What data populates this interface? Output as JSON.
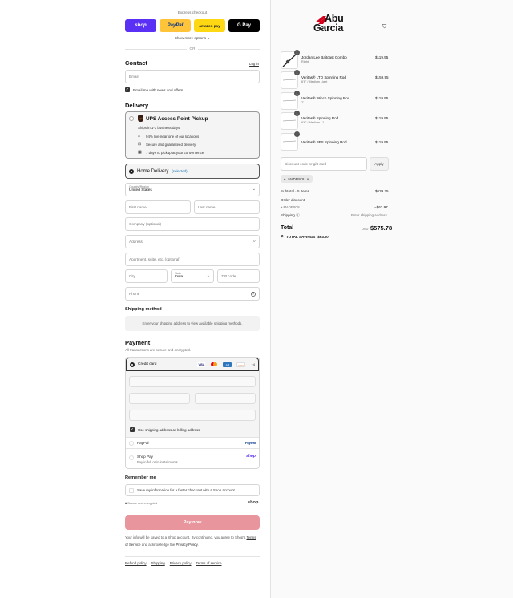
{
  "express": {
    "title": "Express checkout",
    "shop_label": "shop",
    "paypal_label": "PayPal",
    "amazon_label": "amazon pay",
    "gpay_label": "G Pay",
    "more_label": "Show more options",
    "or_label": "OR"
  },
  "contact": {
    "heading": "Contact",
    "login_label": "Log in",
    "email_placeholder": "Email",
    "news_label": "Email me with news and offers"
  },
  "delivery": {
    "heading": "Delivery",
    "ups_title": "UPS Access Point Pickup",
    "ups_subtitle": "Ships in 1-3 business days",
    "ups_features": [
      "94% live near one of our locations",
      "Secure and guaranteed delivery",
      "7 days to pickup at your convenience"
    ],
    "home_label": "Home Delivery",
    "home_selected": "(selected)",
    "country_label": "Country/Region",
    "country_value": "United States",
    "first_name": "First name",
    "last_name": "Last name",
    "company": "Company (optional)",
    "address": "Address",
    "apartment": "Apartment, suite, etc. (optional)",
    "city": "City",
    "state_label": "State",
    "state_value": "Iowa",
    "zip": "ZIP code",
    "phone": "Phone"
  },
  "shipping_method": {
    "heading": "Shipping method",
    "note": "Enter your shipping address to view available shipping methods."
  },
  "payment": {
    "heading": "Payment",
    "subheading": "All transactions are secure and encrypted.",
    "credit_card_label": "Credit card",
    "card_more": "+4",
    "billing_label": "Use shipping address as billing address",
    "paypal_label": "PayPal",
    "paypal_logo": "PayPal",
    "shoppay_label": "Shop Pay",
    "shoppay_sub": "Pay in full or in installments",
    "shoppay_logo": "shop"
  },
  "remember": {
    "heading": "Remember me",
    "save_label": "Save my information for a faster checkout with a Shop account",
    "secure_label": "Secure and encrypted",
    "shop_logo": "shop"
  },
  "pay_button": "Pay now",
  "legal": {
    "text1": "Your info will be saved to a Shop account. By continuing, you agree to Shop's",
    "tos": "Terms of Service",
    "text2": "and acknowledge the",
    "privacy": "Privacy Policy",
    "period": "."
  },
  "footer_links": [
    "Refund policy",
    "Shipping",
    "Privacy policy",
    "Terms of service"
  ],
  "brand": {
    "line1": "Abu",
    "line2": "Garcia"
  },
  "cart": {
    "items": [
      {
        "name": "Jordan Lee Baitcast Combo",
        "variant": "Right",
        "qty": "1",
        "price": "$119.95"
      },
      {
        "name": "Veritas® LTD Spinning Rod",
        "variant": "6'6\" / Medium Light",
        "qty": "1",
        "price": "$159.95"
      },
      {
        "name": "Veritas® Winch Spinning Rod",
        "variant": "7'",
        "qty": "1",
        "price": "$119.95"
      },
      {
        "name": "Veritas® Spinning Rod",
        "variant": "6'6\" / Medium / 1",
        "qty": "1",
        "price": "$119.95"
      },
      {
        "name": "Veritas® BFS Spinning Rod",
        "variant": "",
        "qty": "1",
        "price": "$119.95"
      }
    ],
    "discount_placeholder": "Discount code or gift card",
    "apply_label": "Apply",
    "code_chip": "MADFBC8",
    "subtotal_label": "Subtotal · 5 items",
    "subtotal_value": "$639.75",
    "order_discount_label": "Order discount",
    "order_discount_code": "MADFBC8",
    "order_discount_value": "−$63.97",
    "shipping_label": "Shipping",
    "shipping_value": "Enter shipping address",
    "total_label": "Total",
    "currency": "USD",
    "total_value": "$575.78",
    "savings_label": "TOTAL SAVINGS",
    "savings_value": "$63.97"
  }
}
